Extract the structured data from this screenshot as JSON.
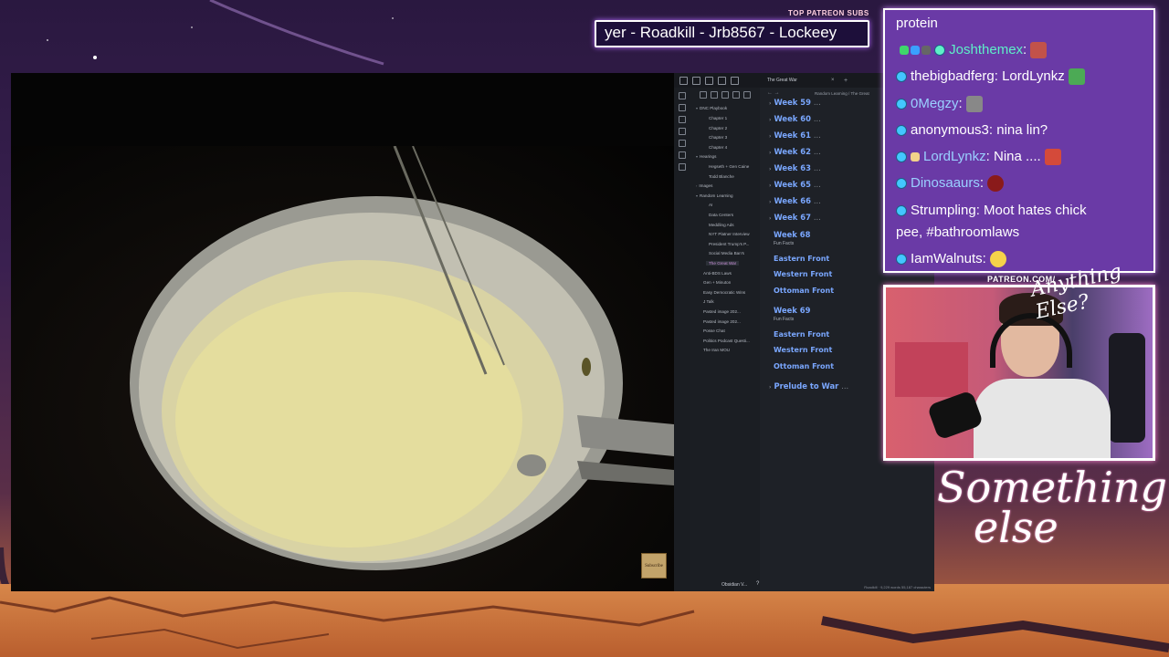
{
  "patreon": {
    "label": "TOP PATREON SUBS",
    "names": "yer - Roadkill - Jrb8567 - Lockeey"
  },
  "chat": {
    "messages": [
      {
        "user": "",
        "text": "protein"
      },
      {
        "user": "Joshthemex",
        "text": ""
      },
      {
        "user": "thebigbadferg",
        "text": " LordLynkz"
      },
      {
        "user": "0Megzy",
        "text": ""
      },
      {
        "user": "anonymous3",
        "text": " nina lin?"
      },
      {
        "user": "LordLynkz",
        "text": " Nina ...."
      },
      {
        "user": "Dinosaaurs",
        "text": ""
      },
      {
        "user": "Strumpling",
        "text": " Moot hates chick"
      },
      {
        "user": "",
        "text": "pee, #bathroomlaws"
      },
      {
        "user": "IamWalnuts",
        "text": ""
      }
    ]
  },
  "webcam": {
    "label": "PATREON.COM/",
    "overlay": "Anything Else?"
  },
  "brand": {
    "line1": "Something",
    "line2": "else"
  },
  "video": {
    "badge": "Subscribe"
  },
  "obsidian": {
    "tab_title": "The Great War",
    "breadcrumb": "Random Learning  /  The Great",
    "vault": "Obsidian V...",
    "status": "Roadkill · 9,229 words  55,187 characters",
    "tree": [
      "DNC Playbook",
      "Chapter 1",
      "Chapter 2",
      "Chapter 3",
      "Chapter 4",
      "Hearings",
      "Hegseth + Gen Caine",
      "Todd Blanche",
      "Images",
      "Random Learning",
      "AI",
      "Data Centers",
      "Meddling Ads",
      "NYT Platner Interview",
      "President Trump's P...",
      "Social Media Ban's",
      "The Great War",
      "Anti-BDS Laws",
      "Gen + Minuton",
      "Easy Democratic Wins",
      "J Talk",
      "Pasted image 202...",
      "Pasted image 202...",
      "Posse Chat",
      "Politics Podcast Questi...",
      "The Iran MOU"
    ],
    "headings": {
      "w59": "Week 59",
      "w60": "Week 60",
      "w61": "Week 61",
      "w62": "Week 62",
      "w63": "Week 63",
      "w65": "Week 65",
      "w66": "Week 66",
      "w67": "Week 67",
      "w68": "Week 68",
      "w69": "Week 69",
      "prelude": "Prelude to War",
      "fun": "Fun Facts",
      "eastern": "Eastern Front",
      "western": "Western Front",
      "ottoman": "Ottoman Front",
      "ellipsis": "..."
    }
  }
}
